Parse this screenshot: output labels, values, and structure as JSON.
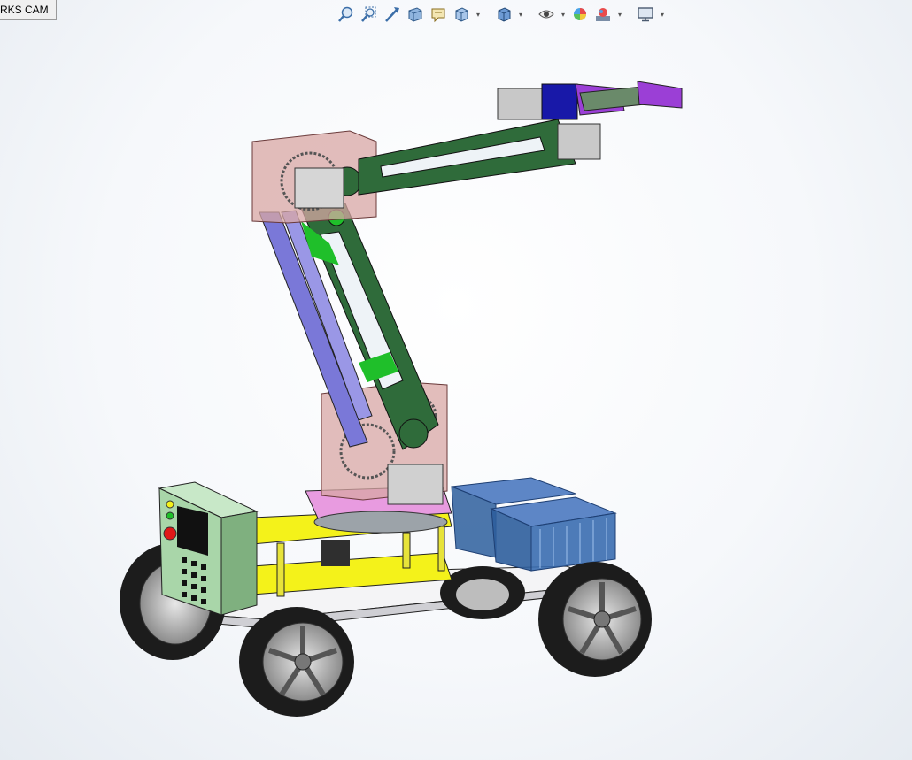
{
  "tab": {
    "label": "RKS CAM"
  },
  "toolbar": {
    "tools": [
      {
        "name": "zoom-to-fit-icon"
      },
      {
        "name": "zoom-to-area-icon"
      },
      {
        "name": "previous-view-icon"
      },
      {
        "name": "section-view-icon"
      },
      {
        "name": "dynamic-annotation-icon"
      },
      {
        "name": "view-orientation-icon",
        "dropdown": true
      },
      {
        "name": "display-style-icon",
        "dropdown": true
      },
      {
        "name": "hide-show-items-icon",
        "dropdown": true
      },
      {
        "name": "edit-appearance-icon"
      },
      {
        "name": "apply-scene-icon",
        "dropdown": true
      },
      {
        "name": "view-settings-icon",
        "dropdown": true
      }
    ]
  },
  "colors": {
    "arm_green": "#2f6b3a",
    "arm_bright_green": "#1fbf2a",
    "link_purple": "#7a78d8",
    "housing_pink": "#d8a7a4",
    "platform_yellow": "#f4f21a",
    "control_box": "#a9d6a9",
    "crate_blue": "#2d5e9c",
    "gripper_purple": "#9b3fd6",
    "tire": "#1c1c1c"
  }
}
